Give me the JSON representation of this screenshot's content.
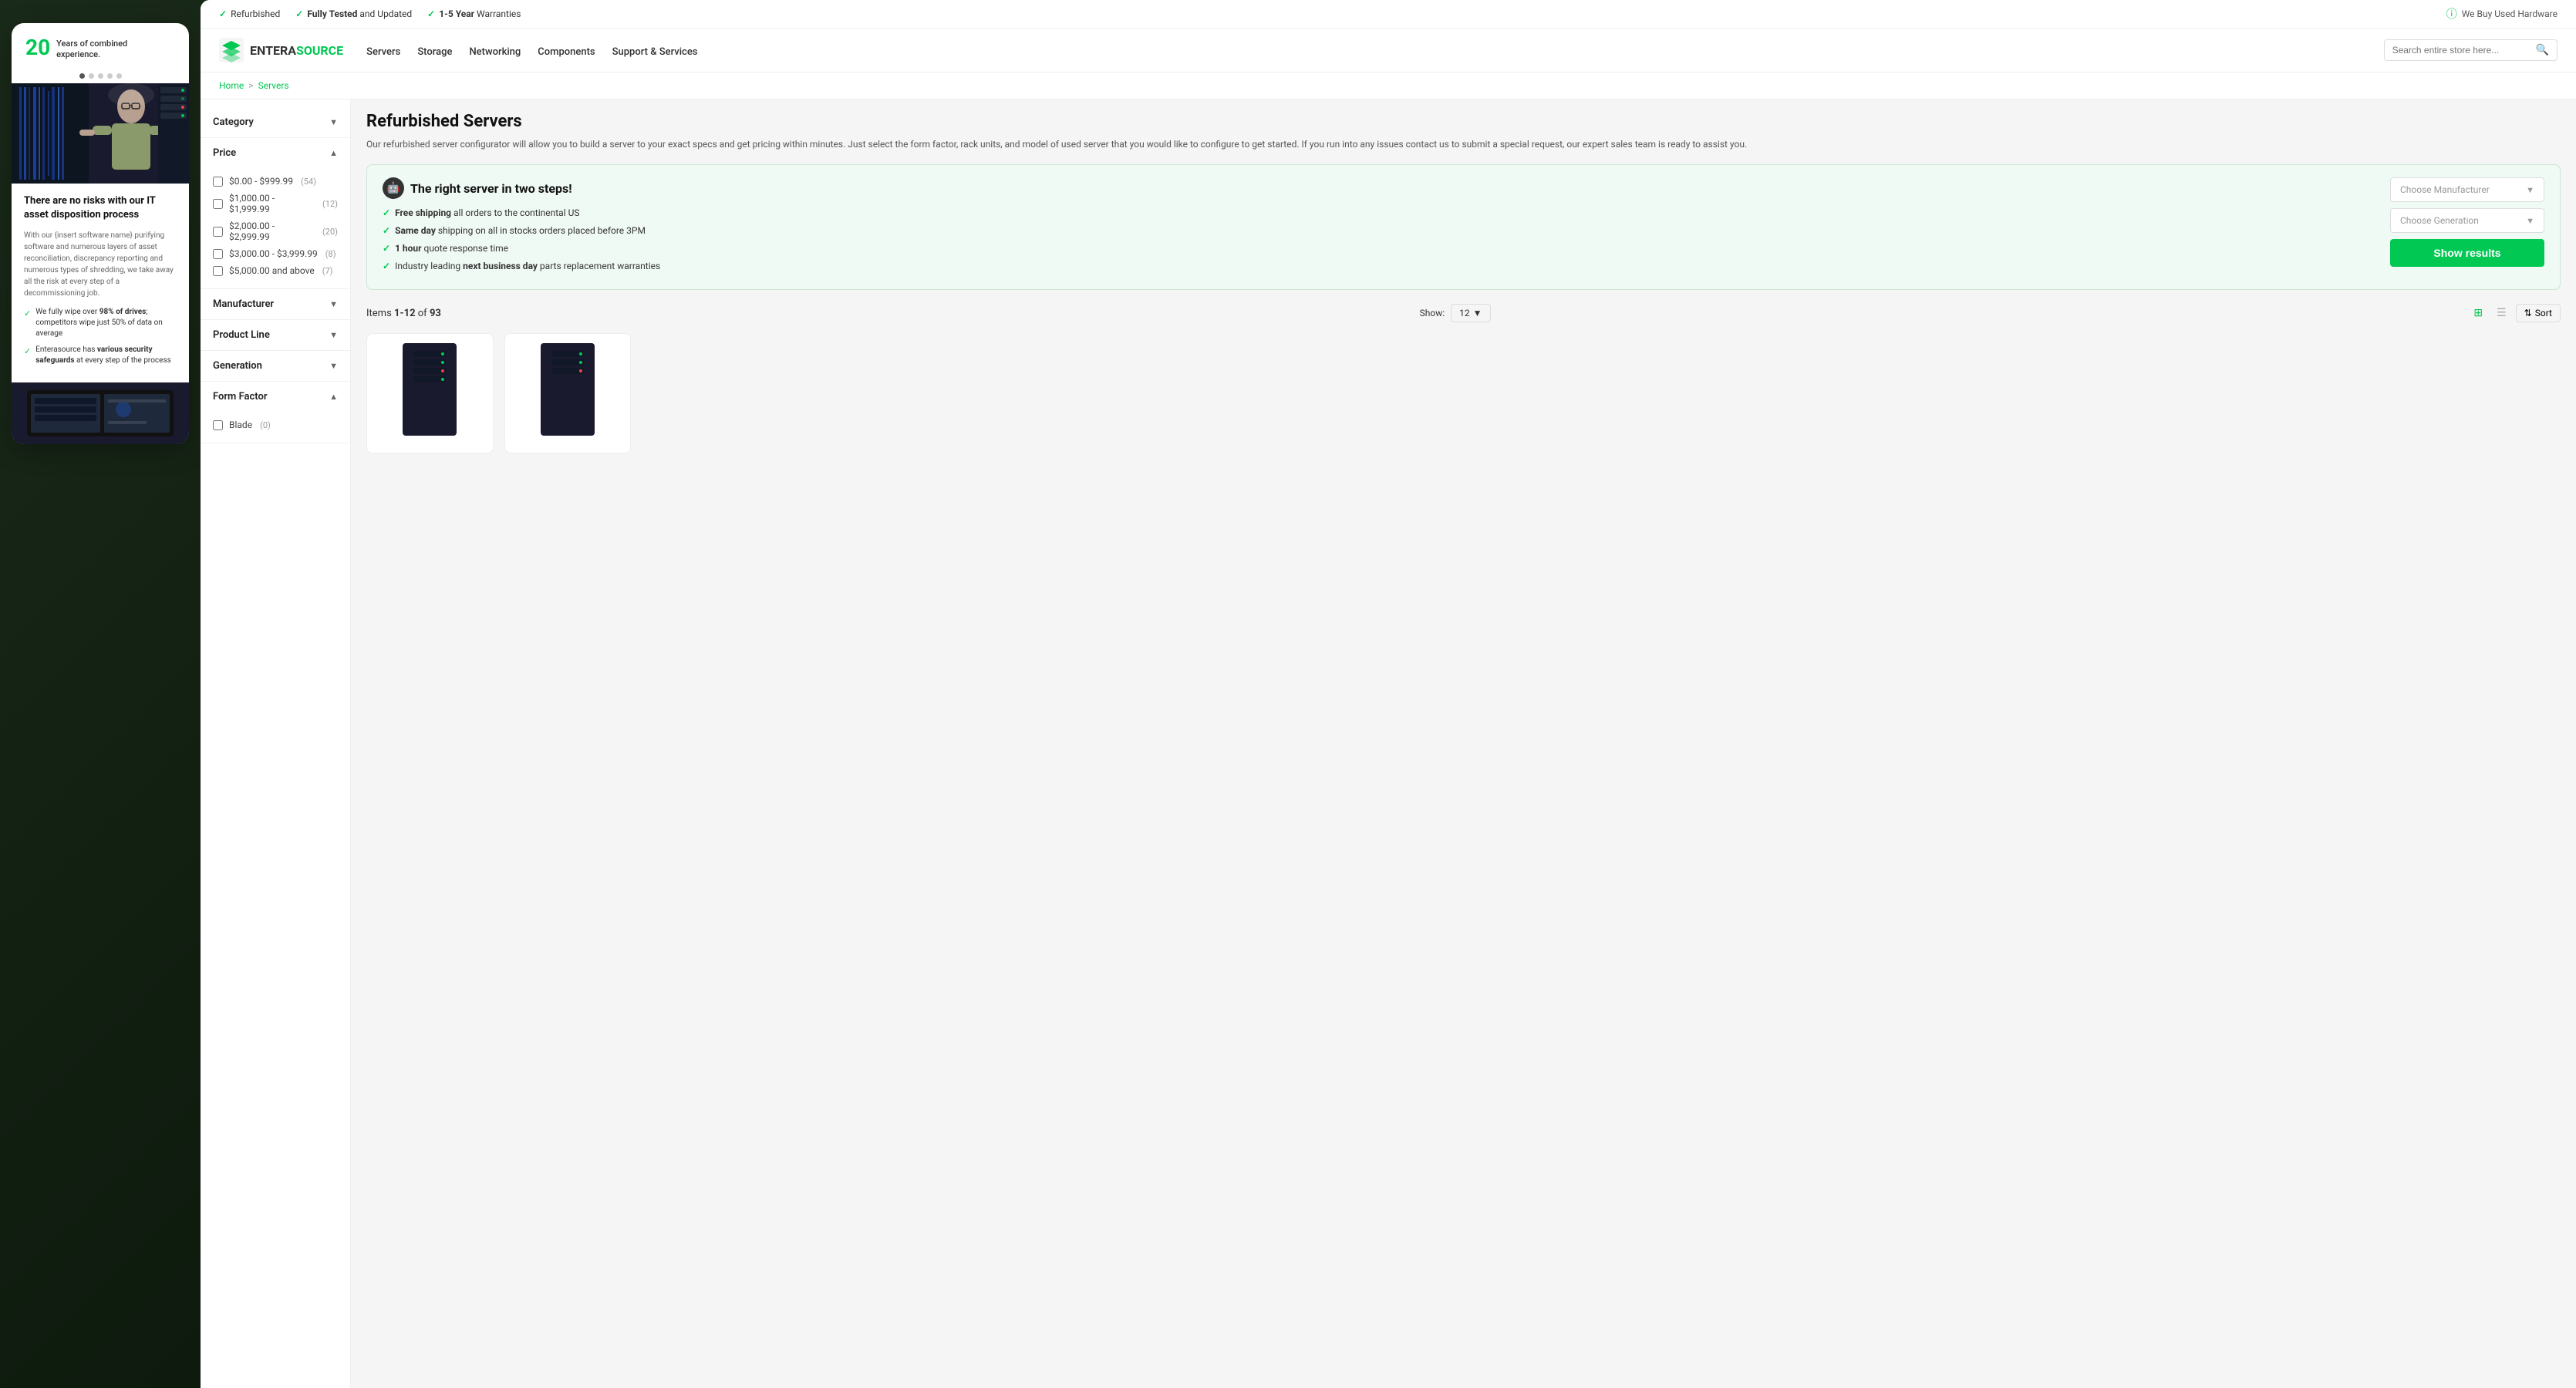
{
  "left_panel": {
    "years_number": "20",
    "years_text": "Years of combined\nexperience.",
    "card_title": "There are no risks with our IT asset disposition process",
    "card_description": "With our {insert software name} purifying software and numerous layers of asset reconciliation, discrepancy reporting and numerous types of shredding, we take away all the risk at every step of a decommissioning job.",
    "check_items": [
      {
        "text_pre": "We fully wipe over ",
        "bold": "98% of drives",
        "text_post": "; competitors wipe just 50% of data on average"
      },
      {
        "text_pre": "Enterasource has ",
        "bold": "various security safeguards",
        "text_post": " at every step of the process"
      }
    ]
  },
  "top_bar": {
    "items": [
      {
        "label": "Refurbished"
      },
      {
        "label_pre": "",
        "bold": "Fully Tested",
        "label_post": " and Updated"
      },
      {
        "label_pre": "",
        "bold": "1-5 Year",
        "label_post": " Warranties"
      }
    ],
    "right_label": "We Buy Used Hardware"
  },
  "nav": {
    "logo_text_pre": "ENTERA",
    "logo_text_post": "SOURCE",
    "links": [
      "Servers",
      "Storage",
      "Networking",
      "Components",
      "Support & Services"
    ],
    "search_placeholder": "Search entire store here..."
  },
  "breadcrumb": {
    "home": "Home",
    "separator": ">",
    "current": "Servers"
  },
  "sidebar": {
    "filters": [
      {
        "label": "Category",
        "expanded": false,
        "options": []
      },
      {
        "label": "Price",
        "expanded": true,
        "options": [
          {
            "label": "$0.00 - $999.99",
            "count": "54"
          },
          {
            "label": "$1,000.00 - $1,999.99",
            "count": "12"
          },
          {
            "label": "$2,000.00 - $2,999.99",
            "count": "20"
          },
          {
            "label": "$3,000.00 - $3,999.99",
            "count": "8"
          },
          {
            "label": "$5,000.00 and above",
            "count": "7"
          }
        ]
      },
      {
        "label": "Manufacturer",
        "expanded": false,
        "options": []
      },
      {
        "label": "Product Line",
        "expanded": false,
        "options": []
      },
      {
        "label": "Generation",
        "expanded": false,
        "options": []
      },
      {
        "label": "Form Factor",
        "expanded": true,
        "options": [
          {
            "label": "Blade",
            "count": "0"
          }
        ]
      }
    ]
  },
  "product_area": {
    "title": "Refurbished Servers",
    "description": "Our refurbished server configurator will allow you to build a server to your exact specs and get pricing within minutes. Just select the form factor, rack units, and model of used server that you would like to configure to get started. If you run into any issues contact us to submit a special request, our expert sales team is ready to assist you.",
    "configurator": {
      "title": "The right server in two steps!",
      "features": [
        {
          "bold_pre": "Free shipping",
          "text": " all orders to the continental US"
        },
        {
          "bold_pre": "Same day",
          "text": " shipping on all in stocks orders placed before 3PM"
        },
        {
          "bold_pre": "1 hour",
          "text": " quote response time"
        },
        {
          "text_pre": "Industry leading ",
          "bold": "next business day",
          "text_post": " parts replacement warranties"
        }
      ],
      "manufacturer_placeholder": "Choose Manufacturer",
      "generation_placeholder": "Choose Generation",
      "show_results_label": "Show results"
    },
    "items_label": "Items",
    "items_start": "1",
    "items_end": "12",
    "items_total": "93",
    "show_label": "Show:",
    "show_value": "12",
    "sort_label": "Sort"
  },
  "colors": {
    "green": "#00c853",
    "dark": "#1a1a2e",
    "light_green_bg": "#f0faf5"
  }
}
